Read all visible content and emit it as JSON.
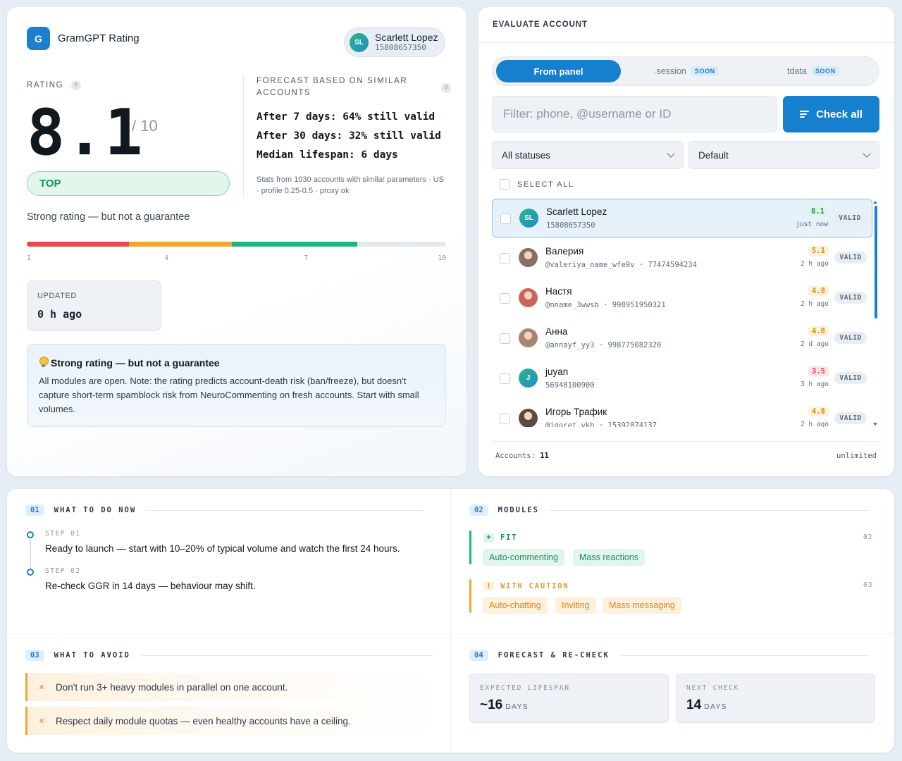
{
  "rating_card": {
    "brand": {
      "logo_letter": "G",
      "name": "GramGPT Rating"
    },
    "user": {
      "initials": "SL",
      "name": "Scarlett Lopez",
      "id": "15808657350"
    },
    "rating_label": "RATING",
    "help_mark": "?",
    "score": "8.1",
    "score_max": "/ 10",
    "badge": "TOP",
    "forecast_label": "FORECAST BASED ON SIMILAR ACCOUNTS",
    "forecast_lines": [
      "After 7 days: 64% still valid",
      "After 30 days: 32% still valid",
      "Median lifespan: 6 days"
    ],
    "forecast_stats": "Stats from 1030 accounts with similar parameters · US · profile 0.25-0.5 · proxy ok",
    "tagline": "Strong rating — but not a guarantee",
    "scale": {
      "segments": [
        {
          "from": 1,
          "to": 3.2,
          "color": "#e5484d"
        },
        {
          "from": 3.2,
          "to": 5.4,
          "color": "#f2a531"
        },
        {
          "from": 5.4,
          "to": 8.1,
          "color": "#1fb57a"
        }
      ],
      "min": 1,
      "max": 10,
      "ticks": [
        "1",
        "4",
        "7",
        "10"
      ]
    },
    "updated": {
      "label": "UPDATED",
      "value": "0 h ago"
    },
    "note": {
      "icon": "lightbulb-icon",
      "title": "Strong rating — but not a guarantee",
      "body": "All modules are open. Note: the rating predicts account-death risk (ban/freeze), but doesn't capture short-term spamblock risk from NeuroCommenting on fresh accounts. Start with small volumes."
    }
  },
  "eval_card": {
    "title": "EVALUATE ACCOUNT",
    "tabs": [
      {
        "label": "From panel",
        "active": true
      },
      {
        "label": ".session",
        "badge": "SOON"
      },
      {
        "label": "tdata",
        "badge": "SOON"
      }
    ],
    "filter_placeholder": "Filter: phone, @username or ID",
    "check_all_label": "Check all",
    "status_select": "All statuses",
    "sort_select": "Default",
    "select_all_label": "SELECT ALL",
    "accounts": [
      {
        "name": "Scarlett Lopez",
        "sub": "15808657350",
        "score": "8.1",
        "level": "green",
        "time": "just now",
        "status": "VALID",
        "avatar": "initials",
        "initials": "SL",
        "avatar_color": "#22a88f",
        "selected": true
      },
      {
        "name": "Валерия",
        "sub": "@valeriya_name_wfe9v  ·  77474594234",
        "score": "5.1",
        "level": "amber",
        "time": "2 h ago",
        "status": "VALID",
        "avatar": "photo",
        "avatar_color": "#8a6e64"
      },
      {
        "name": "Настя",
        "sub": "@nname_3wwsb  ·  998951950321",
        "score": "4.8",
        "level": "amber",
        "time": "2 h ago",
        "status": "VALID",
        "avatar": "photo",
        "avatar_color": "#c9645a"
      },
      {
        "name": "Анна",
        "sub": "@annayf_yy3  ·  998775082320",
        "score": "4.8",
        "level": "amber",
        "time": "2 d ago",
        "status": "VALID",
        "avatar": "photo",
        "avatar_color": "#a8856c"
      },
      {
        "name": "juyan",
        "sub": "56948100900",
        "score": "3.5",
        "level": "red",
        "time": "3 h ago",
        "status": "VALID",
        "avatar": "initials",
        "initials": "J",
        "avatar_color": "#22a88f"
      },
      {
        "name": "Игорь Трафик",
        "sub": "@igoret_vkh  ·  15392074137",
        "score": "4.8",
        "level": "amber",
        "time": "2 h ago",
        "status": "VALID",
        "avatar": "photo",
        "avatar_color": "#5b4a44"
      }
    ],
    "footer_label": "Accounts:",
    "footer_count": "11",
    "footer_right": "unlimited"
  },
  "bottom": {
    "todo": {
      "num": "01",
      "title": "WHAT TO DO NOW",
      "steps": [
        {
          "label": "STEP 01",
          "text": "Ready to launch — start with 10–20% of typical volume and watch the first 24 hours."
        },
        {
          "label": "STEP 02",
          "text": "Re-check GGR in 14 days — behaviour may shift."
        }
      ]
    },
    "modules": {
      "num": "02",
      "title": "MODULES",
      "fit": {
        "mark": "+",
        "title": "FIT",
        "count": "02",
        "items": [
          "Auto-commenting",
          "Mass reactions"
        ]
      },
      "caution": {
        "mark": "!",
        "title": "WITH CAUTION",
        "count": "03",
        "items": [
          "Auto-chatting",
          "Inviting",
          "Mass messaging"
        ]
      }
    },
    "avoid": {
      "num": "03",
      "title": "WHAT TO AVOID",
      "mark": "×",
      "items": [
        "Don't run 3+ heavy modules in parallel on one account.",
        "Respect daily module quotas — even healthy accounts have a ceiling."
      ]
    },
    "forecast": {
      "num": "04",
      "title": "FORECAST & RE-CHECK",
      "lifespan": {
        "label": "EXPECTED LIFESPAN",
        "value": "~16",
        "unit": "DAYS"
      },
      "next_check": {
        "label": "NEXT CHECK",
        "value": "14",
        "unit": "DAYS"
      }
    }
  }
}
